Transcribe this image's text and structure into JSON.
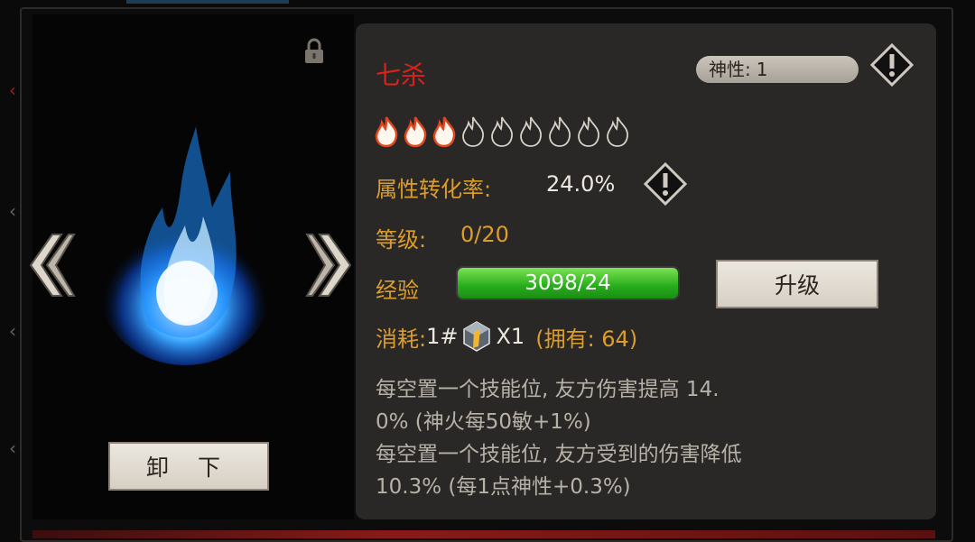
{
  "skill": {
    "name": "七杀",
    "divinity_label": "神性:",
    "divinity_value": "1",
    "flames_total": 9,
    "flames_lit": 3
  },
  "stats": {
    "conversion_label": "属性转化率:",
    "conversion_value": "24.0%",
    "level_label": "等级:",
    "level_value": "0/20",
    "exp_label": "经验",
    "exp_value": "3098/24",
    "exp_fill_ratio": 1.0
  },
  "cost": {
    "label": "消耗:",
    "item_index": "1#",
    "item_icon": "crystal-icon",
    "quantity": "X1",
    "owned": "(拥有: 64)"
  },
  "buttons": {
    "upgrade": "升级",
    "unequip": "卸 下"
  },
  "description": "每空置一个技能位, 友方伤害提高 14.\n0% (神火每50敏+1%)\n每空置一个技能位, 友方受到的伤害降低\n10.3% (每1点神性+0.3%)",
  "colors": {
    "accent_gold": "#dd9d2a",
    "name_red": "#d5241c",
    "flame_blue": "#1e8cff",
    "exp_green": "#27ac1c"
  }
}
